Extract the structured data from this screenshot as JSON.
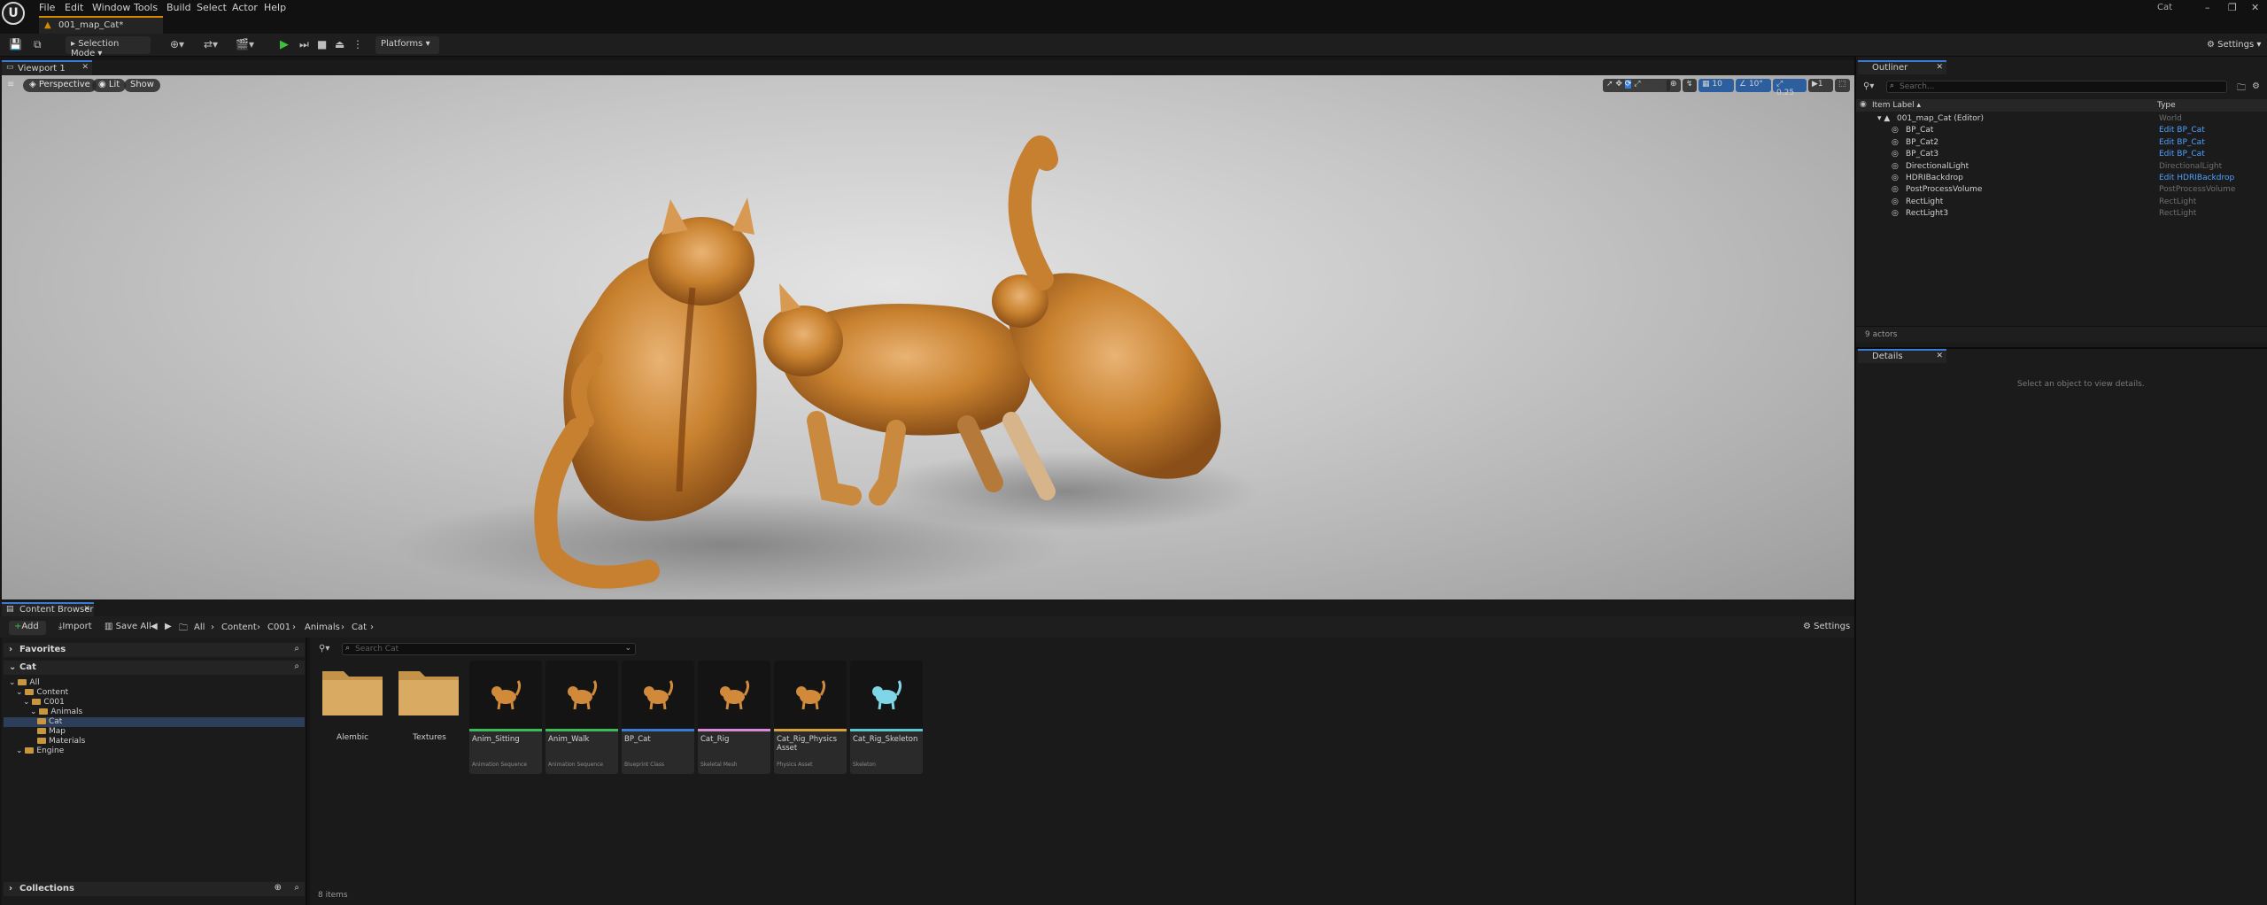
{
  "title_bar": {
    "logo": "U",
    "menus": [
      "File",
      "Edit",
      "Window",
      "Tools",
      "Build",
      "Select",
      "Actor",
      "Help"
    ],
    "project_title": "Cat",
    "window_controls": [
      "–",
      "❐",
      "✕"
    ]
  },
  "level_tab": {
    "label": "001_map_Cat*"
  },
  "main_toolbar": {
    "mode_label": "Selection Mode",
    "platforms_label": "Platforms",
    "settings_label": "Settings"
  },
  "viewport": {
    "tab_label": "Viewport 1",
    "perspective_label": "Perspective",
    "lit_label": "Lit",
    "show_label": "Show",
    "grid_snap": "10",
    "rotation_snap": "10°",
    "scale_snap": "0.25",
    "camera_speed": "1"
  },
  "outliner": {
    "tab_label": "Outliner",
    "search_placeholder": "Search...",
    "col_label": "Item Label ▴",
    "col_type": "Type",
    "rows": [
      {
        "name": "001_map_Cat (Editor)",
        "type": "World",
        "link": false
      },
      {
        "name": "BP_Cat",
        "type": "Edit BP_Cat",
        "link": true
      },
      {
        "name": "BP_Cat2",
        "type": "Edit BP_Cat",
        "link": true
      },
      {
        "name": "BP_Cat3",
        "type": "Edit BP_Cat",
        "link": true
      },
      {
        "name": "DirectionalLight",
        "type": "DirectionalLight",
        "link": false
      },
      {
        "name": "HDRIBackdrop",
        "type": "Edit HDRIBackdrop",
        "link": true
      },
      {
        "name": "PostProcessVolume",
        "type": "PostProcessVolume",
        "link": false
      },
      {
        "name": "RectLight",
        "type": "RectLight",
        "link": false
      },
      {
        "name": "RectLight3",
        "type": "RectLight",
        "link": false
      }
    ],
    "actor_count": "9 actors"
  },
  "details": {
    "tab_label": "Details",
    "empty_message": "Select an object to view details."
  },
  "content_browser": {
    "tab_label": "Content Browser",
    "add_label": "Add",
    "import_label": "Import",
    "save_all_label": "Save All",
    "settings_label": "Settings",
    "breadcrumbs": [
      "All",
      "Content",
      "C001",
      "Animals",
      "Cat"
    ],
    "favorites_label": "Favorites",
    "tree_root_label": "Cat",
    "tree": [
      {
        "label": "All",
        "indent": 0
      },
      {
        "label": "Content",
        "indent": 1
      },
      {
        "label": "C001",
        "indent": 2
      },
      {
        "label": "Animals",
        "indent": 3
      },
      {
        "label": "Cat",
        "indent": 4
      },
      {
        "label": "Map",
        "indent": 4
      },
      {
        "label": "Materials",
        "indent": 4
      },
      {
        "label": "Engine",
        "indent": 1
      }
    ],
    "search_placeholder": "Search Cat",
    "folders": [
      "Alembic",
      "Textures"
    ],
    "assets": [
      {
        "name": "Anim_Sitting",
        "type": "Animation Sequence",
        "color": "#3dbb59"
      },
      {
        "name": "Anim_Walk",
        "type": "Animation Sequence",
        "color": "#3dbb59"
      },
      {
        "name": "BP_Cat",
        "type": "Blueprint Class",
        "color": "#3a7bd5"
      },
      {
        "name": "Cat_Rig",
        "type": "Skeletal Mesh",
        "color": "#d88ad8"
      },
      {
        "name": "Cat_Rig_Physics Asset",
        "type": "Physics Asset",
        "color": "#d8a23a"
      },
      {
        "name": "Cat_Rig_Skeleton",
        "type": "Skeleton",
        "color": "#5ac6d0"
      }
    ],
    "collections_label": "Collections",
    "item_count": "8 items"
  }
}
